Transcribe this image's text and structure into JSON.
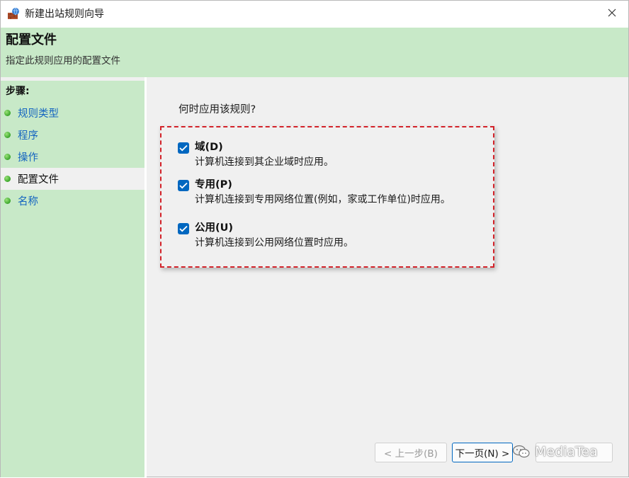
{
  "window": {
    "title": "新建出站规则向导"
  },
  "header": {
    "title": "配置文件",
    "subtitle": "指定此规则应用的配置文件"
  },
  "sidebar": {
    "heading": "步骤:",
    "items": [
      {
        "label": "规则类型"
      },
      {
        "label": "程序"
      },
      {
        "label": "操作"
      },
      {
        "label": "配置文件"
      },
      {
        "label": "名称"
      }
    ],
    "active_index": 3
  },
  "main": {
    "question": "何时应用该规则?",
    "options": [
      {
        "label": "域(D)",
        "description": "计算机连接到其企业域时应用。",
        "checked": true
      },
      {
        "label": "专用(P)",
        "description": "计算机连接到专用网络位置(例如，家或工作单位)时应用。",
        "checked": true
      },
      {
        "label": "公用(U)",
        "description": "计算机连接到公用网络位置时应用。",
        "checked": true
      }
    ]
  },
  "buttons": {
    "back": "< 上一步(B)",
    "next": "下一页(N) >",
    "cancel": ""
  },
  "watermark": {
    "text": "MediaTea"
  },
  "colors": {
    "accent": "#0067c0",
    "panel_green": "#c8e9c8",
    "highlight": "#d3232a"
  }
}
